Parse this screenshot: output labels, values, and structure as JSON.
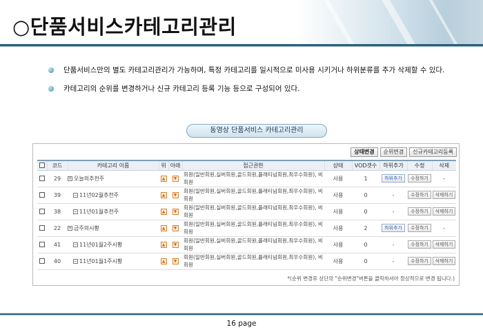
{
  "slide": {
    "title": "○단품서비스카테고리관리",
    "page_label": "16 page"
  },
  "bullets": [
    "단품서비스만의 별도 카테고리관리가 가능하며, 특정 카테고리를 일시적으로 미사용 시키거나 하위분류를 추가 삭제할 수 있다.",
    "카테고리의 순위를 변경하거나 신규 카테고리 등록 기능 등으로 구성되어 있다."
  ],
  "panel_title": "동영상 단품서비스 카테고리관리",
  "toolbar": {
    "status_change": "상태변경",
    "rank_change": "순위변경",
    "new_category": "신규카테고리등록"
  },
  "table": {
    "headers": {
      "code": "코드",
      "name": "카테고리 이름",
      "up": "위",
      "down": "아래",
      "access": "접근권한",
      "status": "상태",
      "vod": "VOD갯수",
      "sub": "하위추가",
      "edit": "수정",
      "delete": "삭제"
    },
    "rows": [
      {
        "code": "29",
        "name": "오늘의추천주",
        "access": "회원(일반회원,실버회원,골드회원,플래티넘회원,최우수회원), 비회원",
        "status": "사용",
        "vod": "1",
        "sub": "하위추가",
        "edit": "수정하기",
        "delete": "-"
      },
      {
        "code": "39",
        "name": "11년02월추천주",
        "access": "회원(일반회원,실버회원,골드회원,플래티넘회원,최우수회원), 비회원",
        "status": "사용",
        "vod": "0",
        "sub": "-",
        "edit": "수정하기",
        "delete": "삭제하기"
      },
      {
        "code": "38",
        "name": "11년01월추천주",
        "access": "회원(일반회원,실버회원,골드회원,플래티넘회원,최우수회원), 비회원",
        "status": "사용",
        "vod": "0",
        "sub": "-",
        "edit": "수정하기",
        "delete": "삭제하기"
      },
      {
        "code": "22",
        "name": "금주의시황",
        "access": "회원(일반회원,실버회원,골드회원,플래티넘회원,최우수회원), 비회원",
        "status": "사용",
        "vod": "2",
        "sub": "하위추가",
        "edit": "수정하기",
        "delete": "-"
      },
      {
        "code": "41",
        "name": "11년01월2주시황",
        "access": "회원(일반회원,실버회원,골드회원,플래티넘회원,최우수회원), 비회원",
        "status": "사용",
        "vod": "0",
        "sub": "-",
        "edit": "수정하기",
        "delete": "삭제하기"
      },
      {
        "code": "40",
        "name": "11년01월1주시황",
        "access": "회원(일반회원,실버회원,골드회원,플래티넘회원,최우수회원), 비회원",
        "status": "사용",
        "vod": "0",
        "sub": "-",
        "edit": "수정하기",
        "delete": "삭제하기"
      }
    ]
  },
  "footnote": "*(순위 변경후 상단의 \"순위변경\"버튼을 클릭하셔야 정상적으로 변경 됩니다.)",
  "icons": {
    "bullet": "bullet-dot-icon",
    "up": "arrow-up-icon",
    "down": "arrow-down-icon",
    "tree": "tree-toggle-icon"
  },
  "colors": {
    "accent": "#2b5f7d",
    "header_bg": "#eaf0f4",
    "arrow": "#d97e24"
  }
}
